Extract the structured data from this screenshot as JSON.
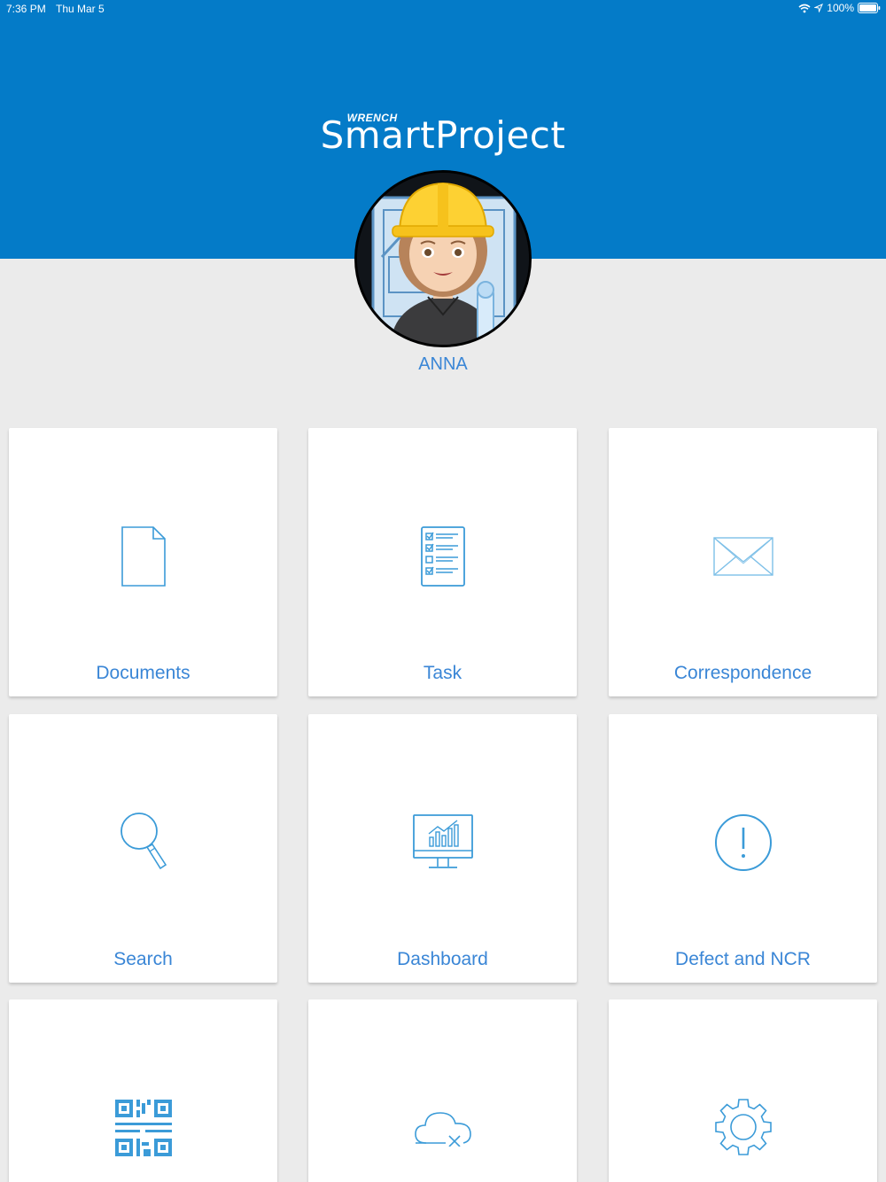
{
  "status_bar": {
    "time": "7:36 PM",
    "date": "Thu Mar 5",
    "battery": "100%"
  },
  "header": {
    "logo_small": "WRENCH",
    "logo_main": "SmartProject"
  },
  "user": {
    "name": "ANNA"
  },
  "tiles": [
    {
      "label": "Documents",
      "icon": "document-icon"
    },
    {
      "label": "Task",
      "icon": "checklist-icon"
    },
    {
      "label": "Correspondence",
      "icon": "envelope-icon"
    },
    {
      "label": "Search",
      "icon": "magnifier-icon"
    },
    {
      "label": "Dashboard",
      "icon": "monitor-chart-icon"
    },
    {
      "label": "Defect and NCR",
      "icon": "exclamation-circle-icon"
    },
    {
      "label": "",
      "icon": "qr-code-icon"
    },
    {
      "label": "",
      "icon": "cloud-offline-icon"
    },
    {
      "label": "",
      "icon": "gear-icon"
    }
  ],
  "colors": {
    "header_blue": "#047bc8",
    "accent_blue": "#3a86d6",
    "icon_blue": "#3b9bd8",
    "background": "#ebebeb"
  }
}
